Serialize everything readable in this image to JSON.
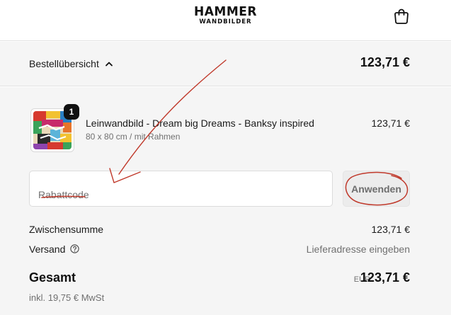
{
  "header": {
    "logo_main": "HAMMER",
    "logo_sub": "WANDBILDER",
    "cart_icon": "shopping-bag-icon"
  },
  "summary": {
    "toggle_label": "Bestellübersicht",
    "toggle_icon": "chevron-up-icon",
    "total": "123,71 €"
  },
  "product": {
    "quantity": "1",
    "title": "Leinwandbild - Dream big Dreams - Banksy inspired",
    "variant": "80 x 80 cm / mit Rahmen",
    "price": "123,71 €"
  },
  "discount": {
    "placeholder": "Rabattcode",
    "apply_label": "Anwenden"
  },
  "totals": {
    "subtotal_label": "Zwischensumme",
    "subtotal_value": "123,71 €",
    "shipping_label": "Versand",
    "shipping_value": "Lieferadresse eingeben",
    "shipping_help_icon": "question-circle-icon",
    "total_label": "Gesamt",
    "currency": "EUR",
    "total_value": "123,71 €",
    "tax_note": "inkl. 19,75 € MwSt"
  },
  "colors": {
    "background": "#f5f5f5",
    "annotation": "#c0392b",
    "text": "#1a1a1a",
    "muted": "#707070"
  }
}
